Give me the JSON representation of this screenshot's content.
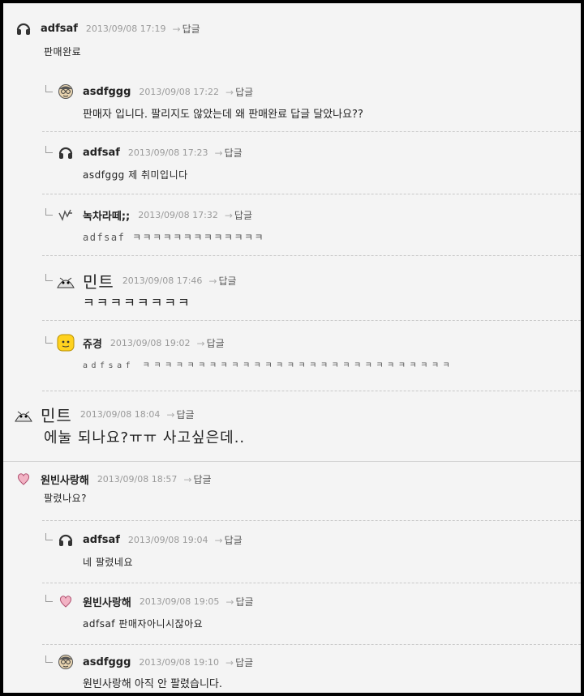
{
  "reply_label": "답글",
  "comments": [
    {
      "nick": "adfsaf",
      "date": "2013/09/08 17:19",
      "text": "판매완료",
      "icon": "headphones-icon"
    },
    {
      "nick": "asdfggg",
      "date": "2013/09/08 17:22",
      "text": "판매자 입니다. 팔리지도 않았는데 왜 판매완료 답글 달았나요??",
      "icon": "face-glasses-icon"
    },
    {
      "nick": "adfsaf",
      "date": "2013/09/08 17:23",
      "text": "asdfggg 제 취미입니다",
      "icon": "headphones-icon"
    },
    {
      "nick": "녹차라떼;;",
      "date": "2013/09/08 17:32",
      "text": "adfsaf ㅋㅋㅋㅋㅋㅋㅋㅋㅋㅋㅋㅋㅋ",
      "icon": "scribble-icon"
    },
    {
      "nick": "민트",
      "date": "2013/09/08 17:46",
      "text": "ㅋㅋㅋㅋㅋㅋㅋㅋ",
      "icon": "mint-character-icon"
    },
    {
      "nick": "쥬경",
      "date": "2013/09/08 19:02",
      "text": "adfsaf ㅋㅋㅋㅋㅋㅋㅋㅋㅋㅋㅋㅋㅋㅋㅋㅋㅋㅋㅋㅋㅋㅋㅋㅋㅋㅋㅋㅋ",
      "icon": "yellow-smiley-icon"
    },
    {
      "nick": "민트",
      "date": "2013/09/08 18:04",
      "text": "에눌 되나요?ㅠㅠ 사고싶은데..",
      "icon": "mint-character-icon"
    },
    {
      "nick": "원빈사랑해",
      "date": "2013/09/08 18:57",
      "text": "팔렸나요?",
      "icon": "heart-icon"
    },
    {
      "nick": "adfsaf",
      "date": "2013/09/08 19:04",
      "text": "네 팔렸네요",
      "icon": "headphones-icon"
    },
    {
      "nick": "원빈사랑해",
      "date": "2013/09/08 19:05",
      "text": "adfsaf 판매자아니시잖아요",
      "icon": "heart-icon"
    },
    {
      "nick": "asdfggg",
      "date": "2013/09/08 19:10",
      "text": "원빈사랑해 아직 안 팔렸습니다.",
      "icon": "face-glasses-icon"
    }
  ]
}
